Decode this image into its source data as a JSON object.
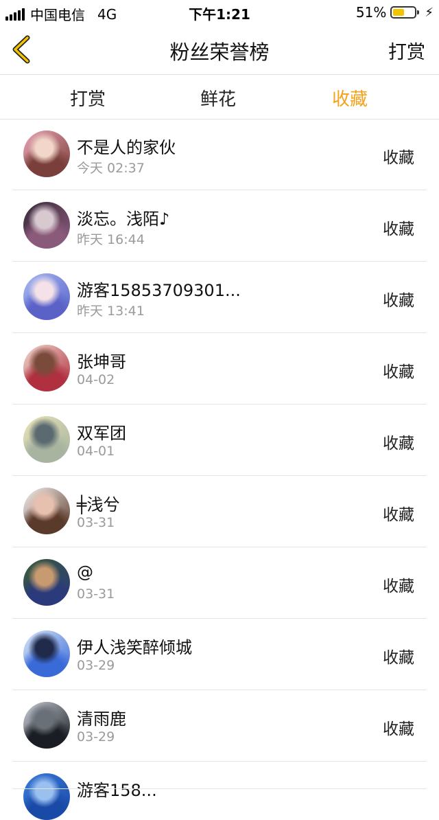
{
  "status_bar": {
    "carrier": "中国电信",
    "network": "4G",
    "time": "下午1:21",
    "battery_percent": "51%",
    "battery_level": 0.51,
    "battery_color": "#f5c400"
  },
  "nav": {
    "back_icon": "chevron-left-icon",
    "title": "粉丝荣誉榜",
    "action_label": "打赏"
  },
  "tabs": [
    {
      "label": "打赏"
    },
    {
      "label": "鲜花"
    },
    {
      "label": "收藏",
      "active": true,
      "color": "#f4a11c"
    }
  ],
  "list": [
    {
      "name": "不是人的家伙",
      "time": "今天 02:37",
      "tag": "收藏",
      "avatar_colors": [
        "#e9a4b4",
        "#7a3f3a",
        "#f2d6c9"
      ]
    },
    {
      "name": "淡忘。浅陌♪",
      "time": "昨天 16:44",
      "tag": "收藏",
      "avatar_colors": [
        "#3a2a3a",
        "#8a5a7a",
        "#d8c8d0"
      ]
    },
    {
      "name": "游客15853709301...",
      "time": "昨天 13:41",
      "tag": "收藏",
      "avatar_colors": [
        "#a6b8f2",
        "#5a62c8",
        "#f4e2e8"
      ]
    },
    {
      "name": "张坤哥",
      "time": "04-02",
      "tag": "收藏",
      "avatar_colors": [
        "#f0d8cc",
        "#b03040",
        "#7a4a3a"
      ]
    },
    {
      "name": "双军团",
      "time": "04-01",
      "tag": "收藏",
      "avatar_colors": [
        "#e8e2b8",
        "#a8b4a0",
        "#5a6a70"
      ]
    },
    {
      "name": "╪浅兮",
      "time": "03-31",
      "tag": "收藏",
      "avatar_colors": [
        "#f4f0ee",
        "#5a3a2a",
        "#e8c0b0"
      ]
    },
    {
      "name": "@",
      "time": "03-31",
      "tag": "收藏",
      "avatar_colors": [
        "#3a5a3a",
        "#2a3a7a",
        "#c89a70"
      ]
    },
    {
      "name": "伊人浅笑醉倾城",
      "time": "03-29",
      "tag": "收藏",
      "avatar_colors": [
        "#d8e6f8",
        "#3a6ad8",
        "#202a4a"
      ]
    },
    {
      "name": "清雨鹿",
      "time": "03-29",
      "tag": "收藏",
      "avatar_colors": [
        "#c8ccd4",
        "#1a1e24",
        "#6a7078"
      ]
    },
    {
      "name": "游客158...",
      "time": "",
      "tag": "",
      "avatar_colors": [
        "#3a7ad8",
        "#1a4aa8",
        "#9ac0f0"
      ]
    }
  ]
}
